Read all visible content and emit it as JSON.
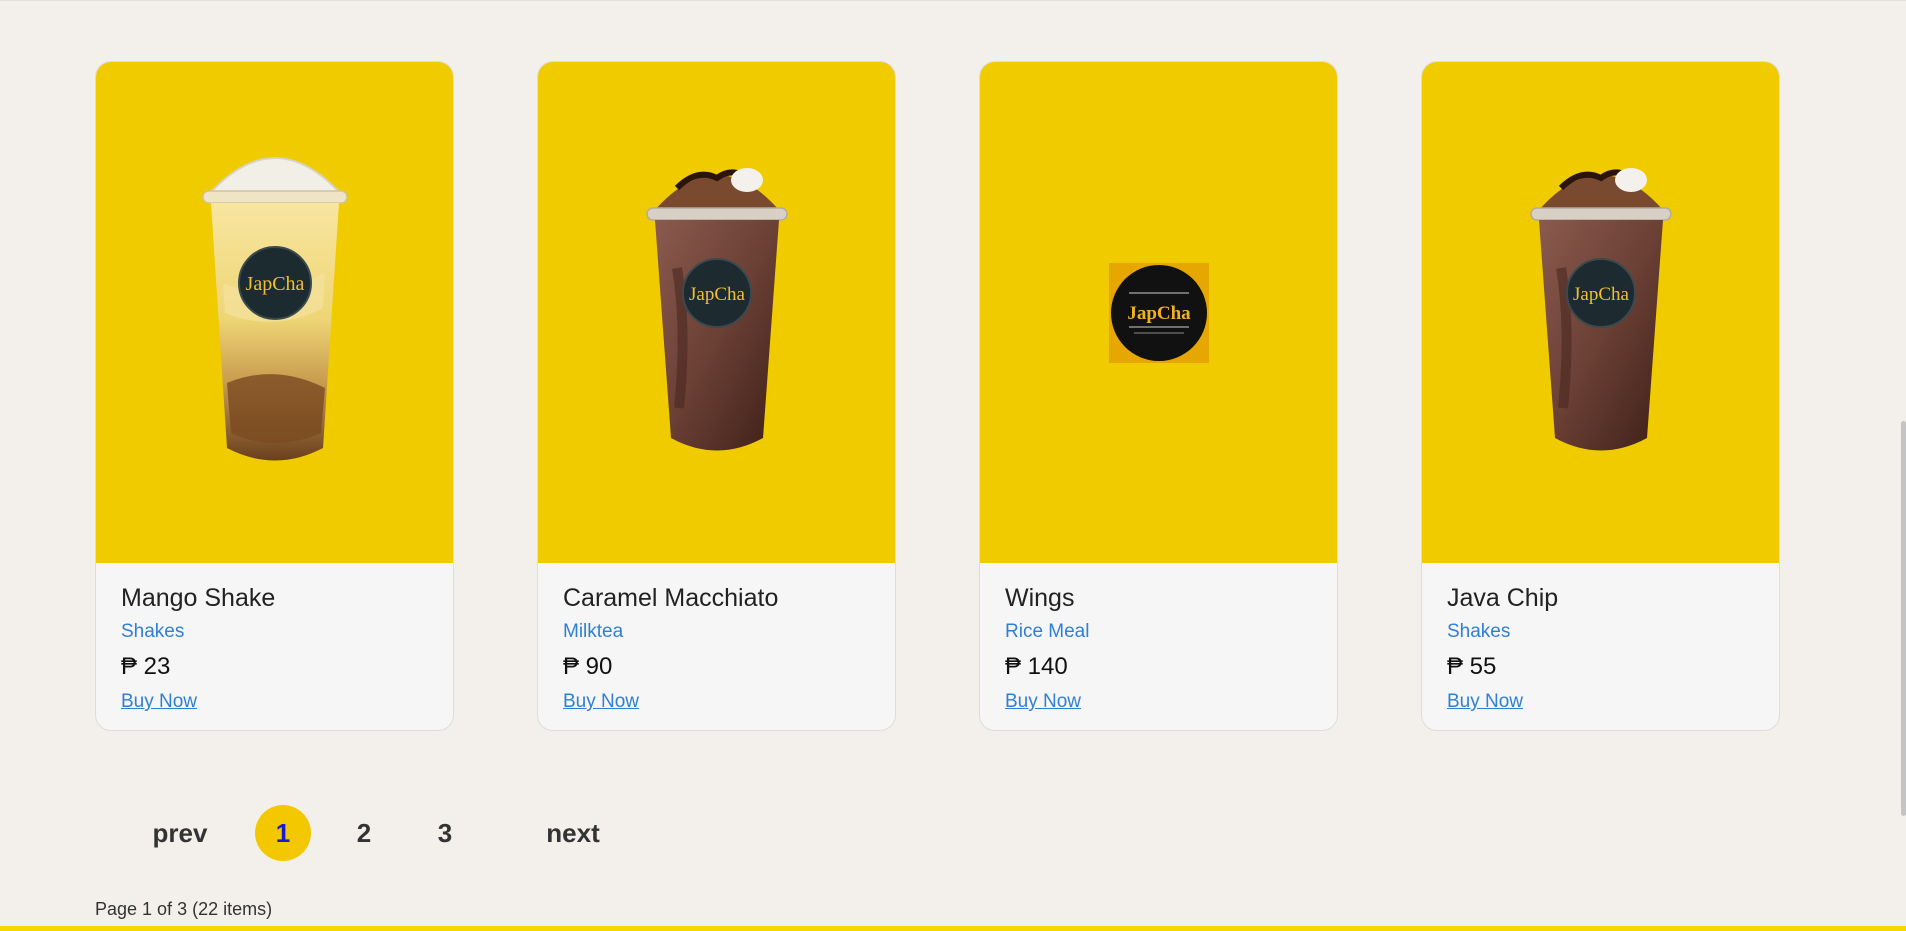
{
  "products": [
    {
      "name": "Mango Shake",
      "category": "Shakes",
      "price": "₱ 23",
      "buy_label": "Buy Now",
      "image": "mango-shake-cup"
    },
    {
      "name": "Caramel Macchiato",
      "category": "Milktea",
      "price": "₱ 90",
      "buy_label": "Buy Now",
      "image": "chocolate-shake-cup"
    },
    {
      "name": "Wings",
      "category": "Rice Meal",
      "price": "₱ 140",
      "buy_label": "Buy Now",
      "image": "japcha-logo"
    },
    {
      "name": "Java Chip",
      "category": "Shakes",
      "price": "₱ 55",
      "buy_label": "Buy Now",
      "image": "chocolate-shake-cup"
    }
  ],
  "logo": {
    "brand": "JapCha"
  },
  "pagination": {
    "prev": "prev",
    "pages": [
      "1",
      "2",
      "3"
    ],
    "next": "next",
    "active": "1",
    "info": "Page 1 of 3 (22 items)"
  },
  "colors": {
    "card_image_bg": "#f0cb00",
    "link": "#2f7fd6",
    "active_page": "#f4c800",
    "page_bg": "#f3f0ec"
  }
}
